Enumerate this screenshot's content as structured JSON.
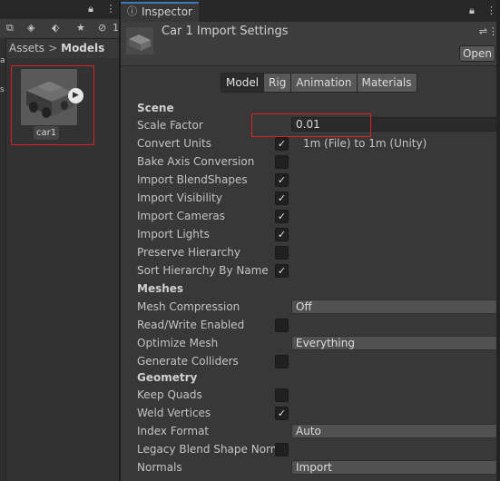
{
  "project": {
    "breadcrumb": {
      "root": "Assets",
      "separator": ">",
      "current": "Models"
    },
    "toolbar_count": "1",
    "asset": {
      "label": "car1"
    }
  },
  "inspector": {
    "tab_label": "Inspector",
    "header_title": "Car 1 Import Settings",
    "open_label": "Open",
    "tabs": [
      {
        "label": "Model",
        "active": true
      },
      {
        "label": "Rig",
        "active": false
      },
      {
        "label": "Animation",
        "active": false
      },
      {
        "label": "Materials",
        "active": false
      }
    ],
    "sections": {
      "scene": "Scene",
      "meshes": "Meshes",
      "geometry": "Geometry"
    },
    "fields": {
      "scale_factor": {
        "label": "Scale Factor",
        "value": "0.01"
      },
      "convert_units": {
        "label": "Convert Units",
        "checked": true,
        "note": "1m (File) to 1m (Unity)"
      },
      "bake_axis_conversion": {
        "label": "Bake Axis Conversion",
        "checked": false
      },
      "import_blendshapes": {
        "label": "Import BlendShapes",
        "checked": true
      },
      "import_visibility": {
        "label": "Import Visibility",
        "checked": true
      },
      "import_cameras": {
        "label": "Import Cameras",
        "checked": true
      },
      "import_lights": {
        "label": "Import Lights",
        "checked": true
      },
      "preserve_hierarchy": {
        "label": "Preserve Hierarchy",
        "checked": false
      },
      "sort_hierarchy": {
        "label": "Sort Hierarchy By Name",
        "checked": true
      },
      "mesh_compression": {
        "label": "Mesh Compression",
        "value": "Off"
      },
      "read_write": {
        "label": "Read/Write Enabled",
        "checked": false
      },
      "optimize_mesh": {
        "label": "Optimize Mesh",
        "value": "Everything"
      },
      "generate_colliders": {
        "label": "Generate Colliders",
        "checked": false
      },
      "keep_quads": {
        "label": "Keep Quads",
        "checked": false
      },
      "weld_vertices": {
        "label": "Weld Vertices",
        "checked": true
      },
      "index_format": {
        "label": "Index Format",
        "value": "Auto"
      },
      "legacy_blend_shape": {
        "label": "Legacy Blend Shape Norm",
        "checked": false
      },
      "normals": {
        "label": "Normals",
        "value": "Import"
      }
    },
    "check_glyph": "✓"
  },
  "colors": {
    "highlight": "#e01f1f",
    "accent": "#3a79bb"
  }
}
